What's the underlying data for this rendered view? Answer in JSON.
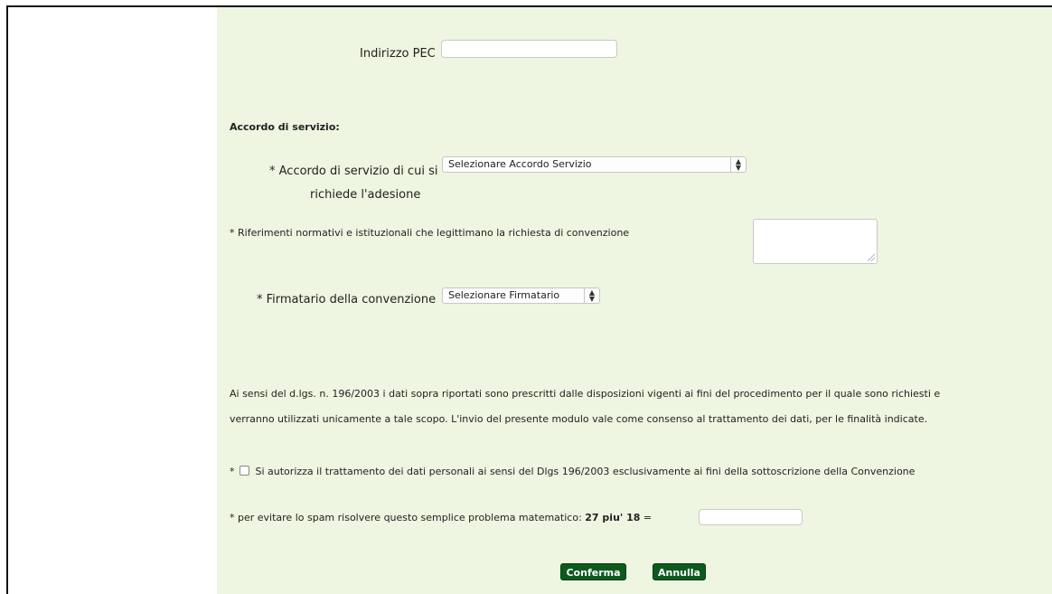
{
  "form": {
    "pec_label": "Indirizzo PEC",
    "pec_value": "",
    "section_title": "Accordo di servizio:",
    "accordo_label_line1": "* Accordo di servizio di cui si",
    "accordo_label_line2": "richiede l'adesione",
    "accordo_select": "Selezionare Accordo Servizio",
    "riferimenti_label": "* Riferimenti normativi e istituzionali che legittimano la richiesta di convenzione",
    "riferimenti_value": "",
    "firmatario_label": "* Firmatario della convenzione",
    "firmatario_select": "Selezionare Firmatario",
    "privacy_line1": "Ai sensi del d.lgs. n. 196/2003 i dati sopra riportati sono prescritti dalle disposizioni vigenti ai fini del procedimento per il quale sono richiesti e",
    "privacy_line2": "verranno utilizzati unicamente a tale scopo. L'invio del presente modulo vale come consenso al trattamento dei dati, per le finalità indicate.",
    "consent_asterisk": "*",
    "consent_label": "Si autorizza il trattamento dei dati personali ai sensi del Dlgs 196/2003 esclusivamente ai fini della sottoscrizione della Convenzione",
    "captcha_label": "* per evitare lo spam risolvere questo semplice problema matematico:",
    "captcha_problem": "27 piu' 18",
    "captcha_equals": "=",
    "captcha_value": "",
    "confirm_button": "Conferma",
    "cancel_button": "Annulla"
  },
  "colors": {
    "panel_bg": "#eef5e0",
    "button_bg": "#0c5a1c"
  }
}
